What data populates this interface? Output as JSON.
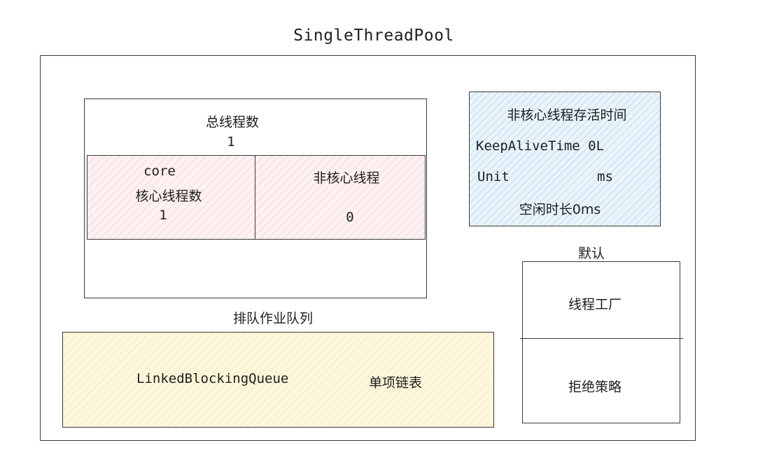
{
  "title": "SingleThreadPool",
  "total_threads": {
    "label": "总线程数",
    "value": "1"
  },
  "core": {
    "tag": "core",
    "label": "核心线程数",
    "value": "1"
  },
  "non_core": {
    "label": "非核心线程",
    "value": "0"
  },
  "keep_alive": {
    "heading": "非核心线程存活时间",
    "time_line": "KeepAliveTime 0L",
    "unit_key": "Unit",
    "unit_value": "ms",
    "idle_note": "空闲时长0ms"
  },
  "queue": {
    "label": "排队作业队列",
    "class_name": "LinkedBlockingQueue",
    "kind": "单项链表"
  },
  "defaults": {
    "label": "默认",
    "thread_factory": "线程工厂",
    "reject_policy": "拒绝策略"
  },
  "colors": {
    "core_fill": "#fdf1f1",
    "keep_alive_fill": "#eaf4fb",
    "queue_fill": "#fcf7dc",
    "stroke": "#3a3a3a"
  }
}
